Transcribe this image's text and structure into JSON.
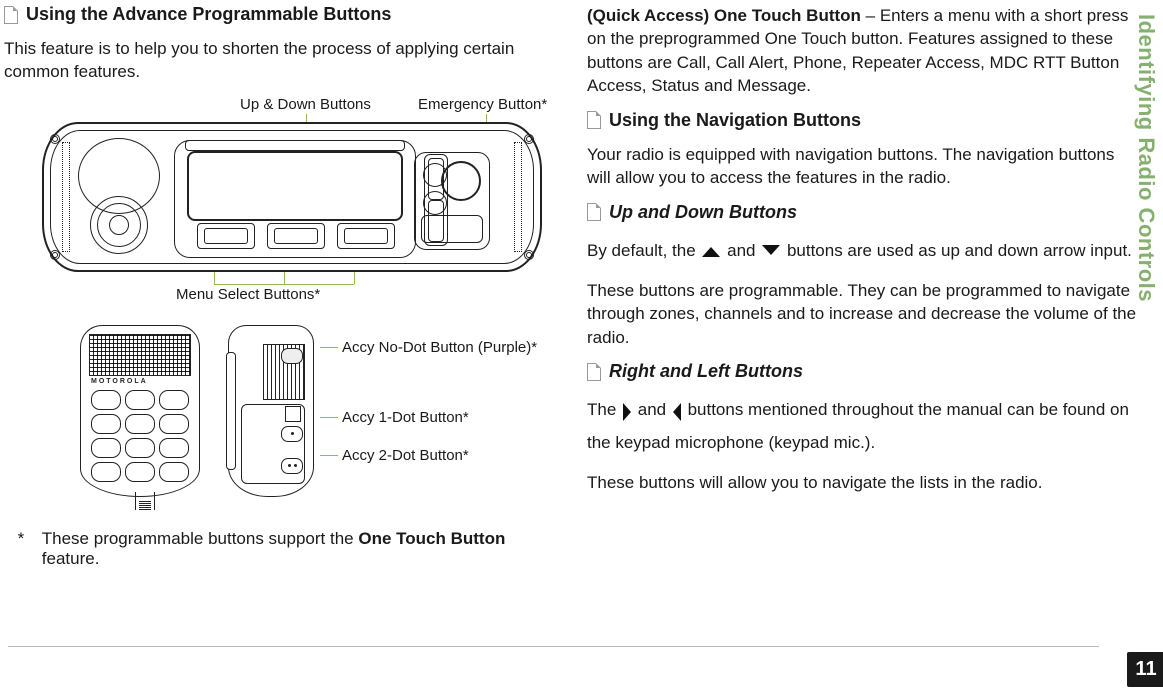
{
  "sidebar": {
    "title": "Identifying Radio Controls",
    "page": "11"
  },
  "left": {
    "h1": "Using the Advance Programmable Buttons",
    "p1": "This feature is to help you to shorten the process of applying certain common features.",
    "labels": {
      "updown": "Up & Down Buttons",
      "emergency": "Emergency Button*",
      "menu": "Menu Select Buttons*",
      "accy_no": "Accy No-Dot Button (Purple)*",
      "accy_1": "Accy 1-Dot Button*",
      "accy_2": "Accy 2-Dot Button*"
    },
    "footnote_mark": "*",
    "footnote_a": "These programmable buttons support the ",
    "footnote_b": "One Touch Button",
    "footnote_c": " feature."
  },
  "right": {
    "qa_head": "(Quick Access) One Touch Button",
    "qa_body": " – Enters a menu with a short press on the preprogrammed One Touch button. Features assigned to these buttons are Call, Call Alert, Phone, Repeater Access, MDC RTT Button Access, Status and Message.",
    "h2": "Using the Navigation Buttons",
    "p2": "Your radio is equipped with navigation buttons.  The navigation buttons will allow you to access the features in the radio.",
    "h3": "Up and Down Buttons",
    "p3_a": "By default, the ",
    "p3_b": " and ",
    "p3_c": " buttons are used as up and down arrow input.",
    "p4": "These buttons are programmable.  They can be programmed to navigate through zones, channels and to increase and decrease the volume of the radio.",
    "h4": "Right and Left Buttons",
    "p5_a": "The ",
    "p5_b": " and ",
    "p5_c": " buttons mentioned throughout the manual can be found on the keypad microphone (keypad mic.).",
    "p6": "These buttons will allow you to navigate the lists in the radio."
  }
}
